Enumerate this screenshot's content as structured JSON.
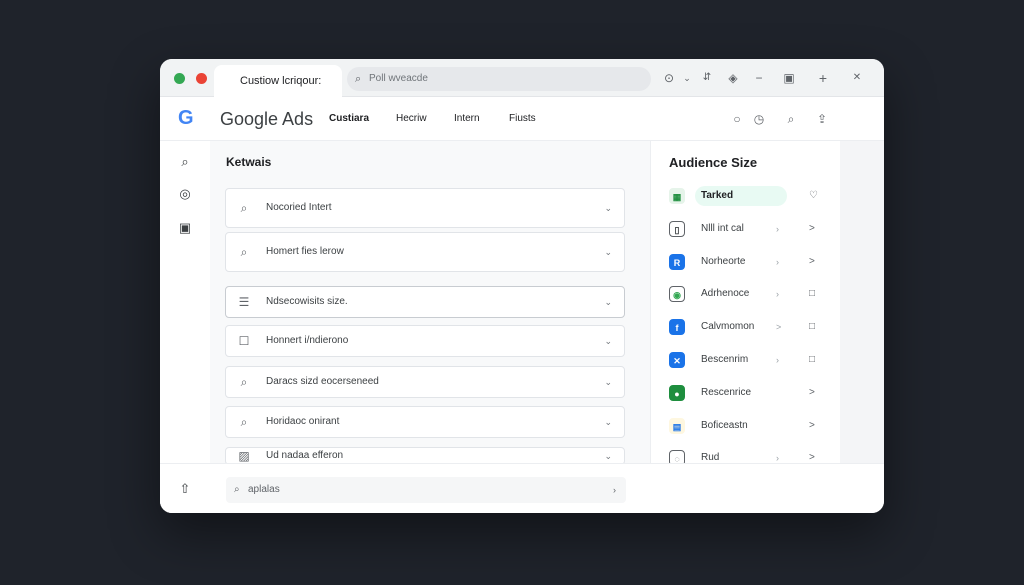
{
  "browser": {
    "tab_title": "Custiow lcriqour:",
    "address_placeholder": "Poll wveacde",
    "dot_colors": [
      "#34a853",
      "#ea4335",
      "#fbbc04"
    ]
  },
  "header": {
    "logo_letter": "G",
    "brand": "Google Ads",
    "nav": [
      "Custiara",
      "Hecriw",
      "Intern",
      "Fiusts"
    ]
  },
  "main": {
    "section_title": "Ketwais",
    "keywords": [
      {
        "icon": "search-icon",
        "label": "Nocoried Intert"
      },
      {
        "icon": "search-icon",
        "label": "Homert fies lerow"
      },
      {
        "icon": "list-icon",
        "label": "Ndsecowisits size."
      },
      {
        "icon": "checkbox-icon",
        "label": "Honnert i/ndierono"
      },
      {
        "icon": "search-icon",
        "label": "Daracs sizd eocerseneed"
      },
      {
        "icon": "search-icon",
        "label": "Horidaoc onirant"
      },
      {
        "icon": "image-icon",
        "label": "Ud nadaa efferon"
      }
    ],
    "footer_search": "aplalas"
  },
  "audience": {
    "title": "Audience Size",
    "items": [
      {
        "label": "Tarked",
        "icon_glyph": "▦",
        "icon_color": "#1e8e3e",
        "icon_bg": "#e6f4ea",
        "end": "♡",
        "mid": ""
      },
      {
        "label": "Nlll int cal",
        "icon_glyph": "▯",
        "icon_color": "#3c4043",
        "icon_bg": "#ffffff",
        "end": ">",
        "mid": "›"
      },
      {
        "label": "Norheorte",
        "icon_glyph": "R",
        "icon_color": "#ffffff",
        "icon_bg": "#1a73e8",
        "end": ">",
        "mid": "›"
      },
      {
        "label": "Adrhenoce",
        "icon_glyph": "◉",
        "icon_color": "#34a853",
        "icon_bg": "#ffffff",
        "end": "□",
        "mid": "›"
      },
      {
        "label": "Calvmomon",
        "icon_glyph": "f",
        "icon_color": "#ffffff",
        "icon_bg": "#1a73e8",
        "end": "□",
        "mid": ">"
      },
      {
        "label": "Bescenrim",
        "icon_glyph": "✕",
        "icon_color": "#ffffff",
        "icon_bg": "#1a73e8",
        "end": "□",
        "mid": "›"
      },
      {
        "label": "Rescenrice",
        "icon_glyph": "●",
        "icon_color": "#ffffff",
        "icon_bg": "#1e8e3e",
        "end": ">",
        "mid": ""
      },
      {
        "label": "Boficeastn",
        "icon_glyph": "▤",
        "icon_color": "#1a73e8",
        "icon_bg": "#fef7e0",
        "end": ">",
        "mid": ""
      },
      {
        "label": "Rud",
        "icon_glyph": "◌",
        "icon_color": "#5f6368",
        "icon_bg": "#ffffff",
        "end": ">",
        "mid": "›"
      }
    ]
  }
}
